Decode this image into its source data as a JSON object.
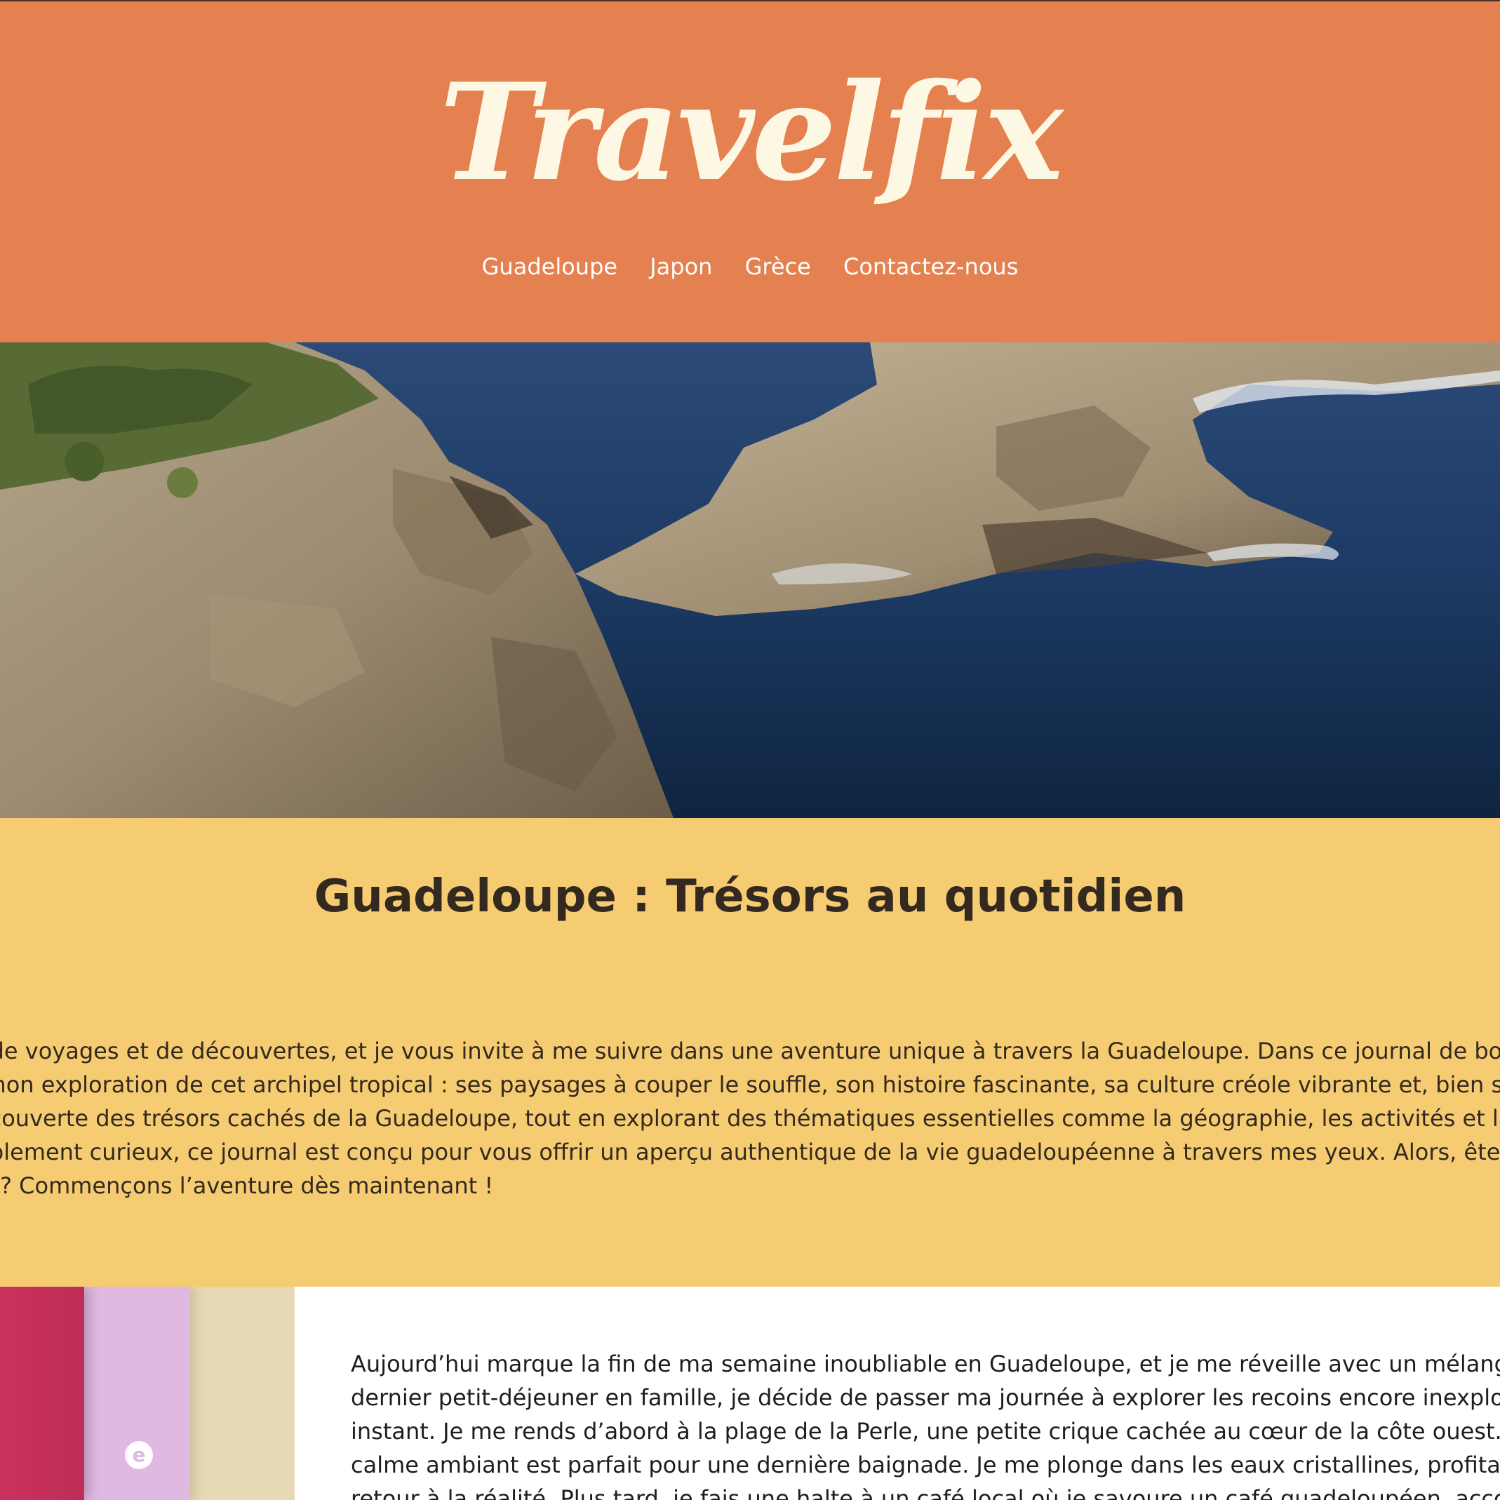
{
  "header": {
    "logo": "Travelfix",
    "nav": [
      "Guadeloupe",
      "Japon",
      "Grèce",
      "Contactez-nous"
    ]
  },
  "intro": {
    "title": "Guadeloupe : Trésors au quotidien",
    "lines": [
      "de voyages et de découvertes, et je vous invite à me suivre dans une aventure unique à travers la Guadeloupe. Dans ce journal de bor",
      "mon exploration de cet archipel tropical : ses paysages à couper le souffle, son histoire fascinante, sa culture créole vibrante et, bien sû",
      "couverte des trésors cachés de la Guadeloupe, tout en explorant des thématiques essentielles comme la géographie, les activités et la",
      "plement curieux, ce journal est conçu pour vous offrir un aperçu authentique de la vie guadeloupéenne à travers mes yeux. Alors, êtes",
      "? Commençons l’aventure dès maintenant !"
    ]
  },
  "journal": {
    "tab_icon": "e",
    "lines": [
      "Aujourd’hui marque la fin de ma semaine inoubliable en Guadeloupe, et je me réveille avec un mélang",
      "dernier petit-déjeuner en famille, je décide de passer ma journée à explorer les recoins encore inexplor",
      "instant. Je me rends d’abord à la plage de la Perle, une petite crique cachée au cœur de la côte ouest.",
      "calme ambiant est parfait pour une dernière baignade. Je me plonge dans les eaux cristallines, profita",
      "retour à la réalité. Plus tard, je fais une halte à un café local où je savoure un café guadeloupéen, acco"
    ]
  },
  "colors": {
    "header_bg": "#e58150",
    "logo": "#fdf8e3",
    "intro_bg": "#f6cc73",
    "tab_red": "#c9325c",
    "tab_lilac": "#dfb9e1",
    "tab_beige": "#e7d9b5"
  }
}
